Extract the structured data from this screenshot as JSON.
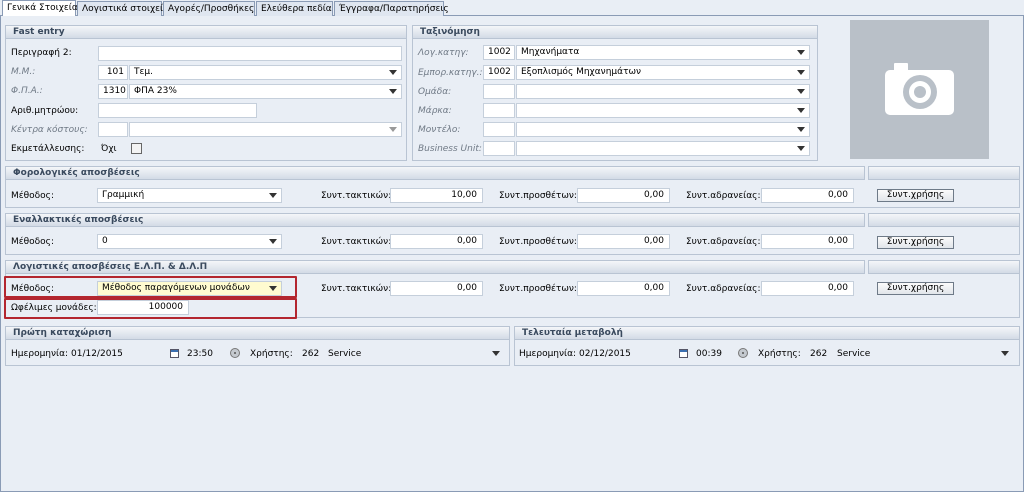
{
  "tabs": [
    "Γενικά Στοιχεία",
    "Λογιστικά στοιχεία",
    "Αγορές/Προσθήκες",
    "Ελεύθερα πεδία",
    "Έγγραφα/Παρατηρήσεις"
  ],
  "fast_entry": {
    "title": "Fast entry",
    "description2_label": "Περιγραφή 2:",
    "description2_value": "",
    "mm_label": "Μ.Μ.:",
    "mm_code": "101",
    "mm_value": "Τεμ.",
    "fpa_label": "Φ.Π.Α.:",
    "fpa_code": "1310",
    "fpa_value": "ΦΠΑ 23%",
    "serial_label": "Αριθ.μητρώου:",
    "serial_value": "",
    "cost_center_label": "Κέντρα κόστους:",
    "cost_center_value": "",
    "exploitation_label": "Εκμετάλλευσης:",
    "exploitation_value": "Όχι"
  },
  "classification": {
    "title": "Ταξινόμηση",
    "account_category_label": "Λογ.κατηγ:",
    "account_category_code": "1002",
    "account_category_value": "Μηχανήματα",
    "commercial_category_label": "Εμπορ.κατηγ.:",
    "commercial_category_code": "1002",
    "commercial_category_value": "Εξοπλισμός Μηχανημάτων",
    "group_label": "Ομάδα:",
    "brand_label": "Μάρκα:",
    "model_label": "Μοντέλο:",
    "business_unit_label": "Business Unit:"
  },
  "tax_depreciation": {
    "title": "Φορολογικές αποσβέσεις",
    "method_label": "Μέθοδος:",
    "method_value": "Γραμμική",
    "regular_label": "Συντ.τακτικών:",
    "regular_value": "10,00",
    "additional_label": "Συντ.προσθέτων:",
    "additional_value": "0,00",
    "idle_label": "Συντ.αδρανείας:",
    "idle_value": "0,00",
    "usage_button": "Συντ.χρήσης"
  },
  "alt_depreciation": {
    "title": "Εναλλακτικές αποσβέσεις",
    "method_label": "Μέθοδος:",
    "method_value": "0",
    "regular_label": "Συντ.τακτικών:",
    "regular_value": "0,00",
    "additional_label": "Συντ.προσθέτων:",
    "additional_value": "0,00",
    "idle_label": "Συντ.αδρανείας:",
    "idle_value": "0,00",
    "usage_button": "Συντ.χρήσης"
  },
  "acc_depreciation": {
    "title": "Λογιστικές αποσβέσεις Ε.Λ.Π. & Δ.Λ.Π",
    "method_label": "Μέθοδος:",
    "method_value": "Μέθοδος παραγόμενων μονάδων",
    "regular_label": "Συντ.τακτικών:",
    "regular_value": "0,00",
    "additional_label": "Συντ.προσθέτων:",
    "additional_value": "0,00",
    "idle_label": "Συντ.αδρανείας:",
    "idle_value": "0,00",
    "usage_button": "Συντ.χρήσης",
    "useful_units_label": "Ωφέλιμες μονάδες:",
    "useful_units_value": "100000"
  },
  "first_entry": {
    "title": "Πρώτη καταχώριση",
    "date_label": "Ημερομηνία:",
    "date_value": "01/12/2015",
    "time_value": "23:50",
    "user_label": "Χρήστης:",
    "user_code": "262",
    "user_name": "Service"
  },
  "last_change": {
    "title": "Τελευταία μεταβολή",
    "date_label": "Ημερομηνία:",
    "date_value": "02/12/2015",
    "time_value": "00:39",
    "user_label": "Χρήστης:",
    "user_code": "262",
    "user_name": "Service"
  },
  "colors": {
    "highlight_border": "#b3262f",
    "selected_field": "#fffbd0",
    "panel_bg": "#e9eef5"
  }
}
